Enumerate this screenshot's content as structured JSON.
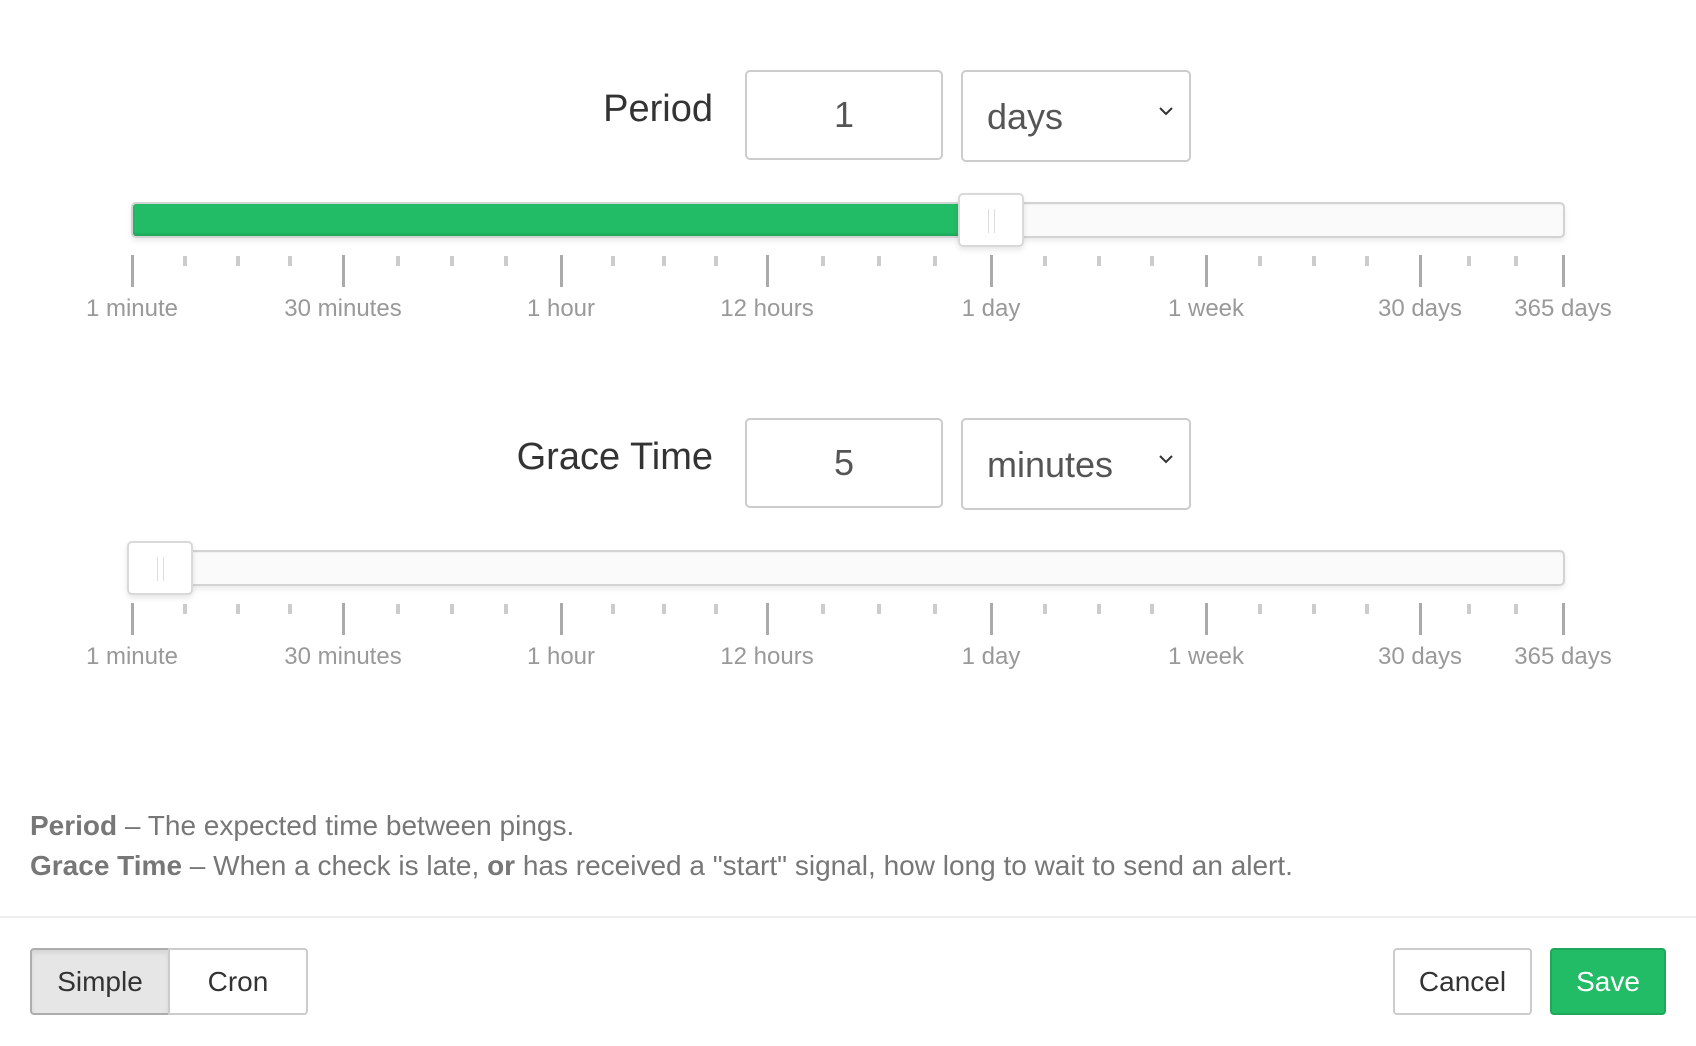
{
  "period": {
    "label": "Period",
    "value": "1",
    "unit": "days",
    "slider_fraction": 0.6
  },
  "grace": {
    "label": "Grace Time",
    "value": "5",
    "unit": "minutes",
    "slider_fraction": 0.0
  },
  "scale": {
    "labels": [
      "1 minute",
      "30 minutes",
      "1 hour",
      "12 hours",
      "1 day",
      "1 week",
      "30 days",
      "365 days"
    ]
  },
  "help": {
    "period_term": "Period",
    "period_desc": " – The expected time between pings.",
    "grace_term": "Grace Time",
    "grace_desc_1": " – When a check is late, ",
    "grace_or": "or",
    "grace_desc_2": " has received a \"start\" signal, how long to wait to send an alert."
  },
  "footer": {
    "simple_label": "Simple",
    "cron_label": "Cron",
    "cancel_label": "Cancel",
    "save_label": "Save"
  },
  "colors": {
    "accent": "#22bb66"
  }
}
